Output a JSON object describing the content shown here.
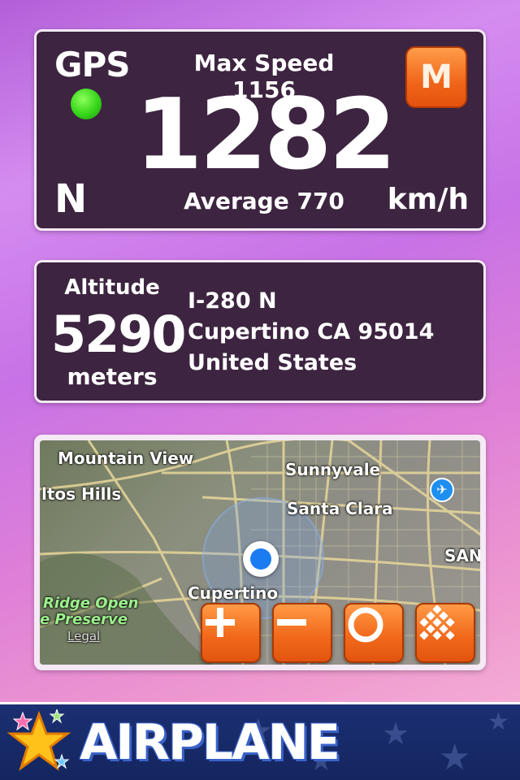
{
  "speed_panel": {
    "gps_label": "GPS",
    "gps_status_color": "#36d51a",
    "heading": "N",
    "max_speed": "Max Speed 1156",
    "speed": "1282",
    "average": "Average 770",
    "unit": "km/h",
    "mode_button": "M"
  },
  "info_panel": {
    "altitude_label": "Altitude",
    "altitude_value": "5290",
    "altitude_unit": "meters",
    "address": [
      "I-280 N",
      "Cupertino CA 95014",
      "United States"
    ]
  },
  "map": {
    "labels": {
      "mountain_view": "Mountain View",
      "los_altos_hills": "ltos Hills",
      "sunnyvale": "Sunnyvale",
      "santa_clara": "Santa Clara",
      "san_jose": "SAN",
      "cupertino": "Cupertino",
      "ridge_open": "Ridge Open",
      "preserve": "e Preserve",
      "legal": "Legal"
    },
    "buttons": {
      "zoom_in": "zoom-in-icon",
      "zoom_out": "zoom-out-icon",
      "locate": "locate-icon",
      "map_type": "grid-icon"
    },
    "location_color": "#1b7cf2"
  },
  "banner": {
    "title": "AIRPLANE",
    "icon": "star-icon"
  },
  "colors": {
    "panel_bg": "#3d2440",
    "accent_orange": "#f26a1c",
    "banner_bg": "#1b2f72"
  }
}
